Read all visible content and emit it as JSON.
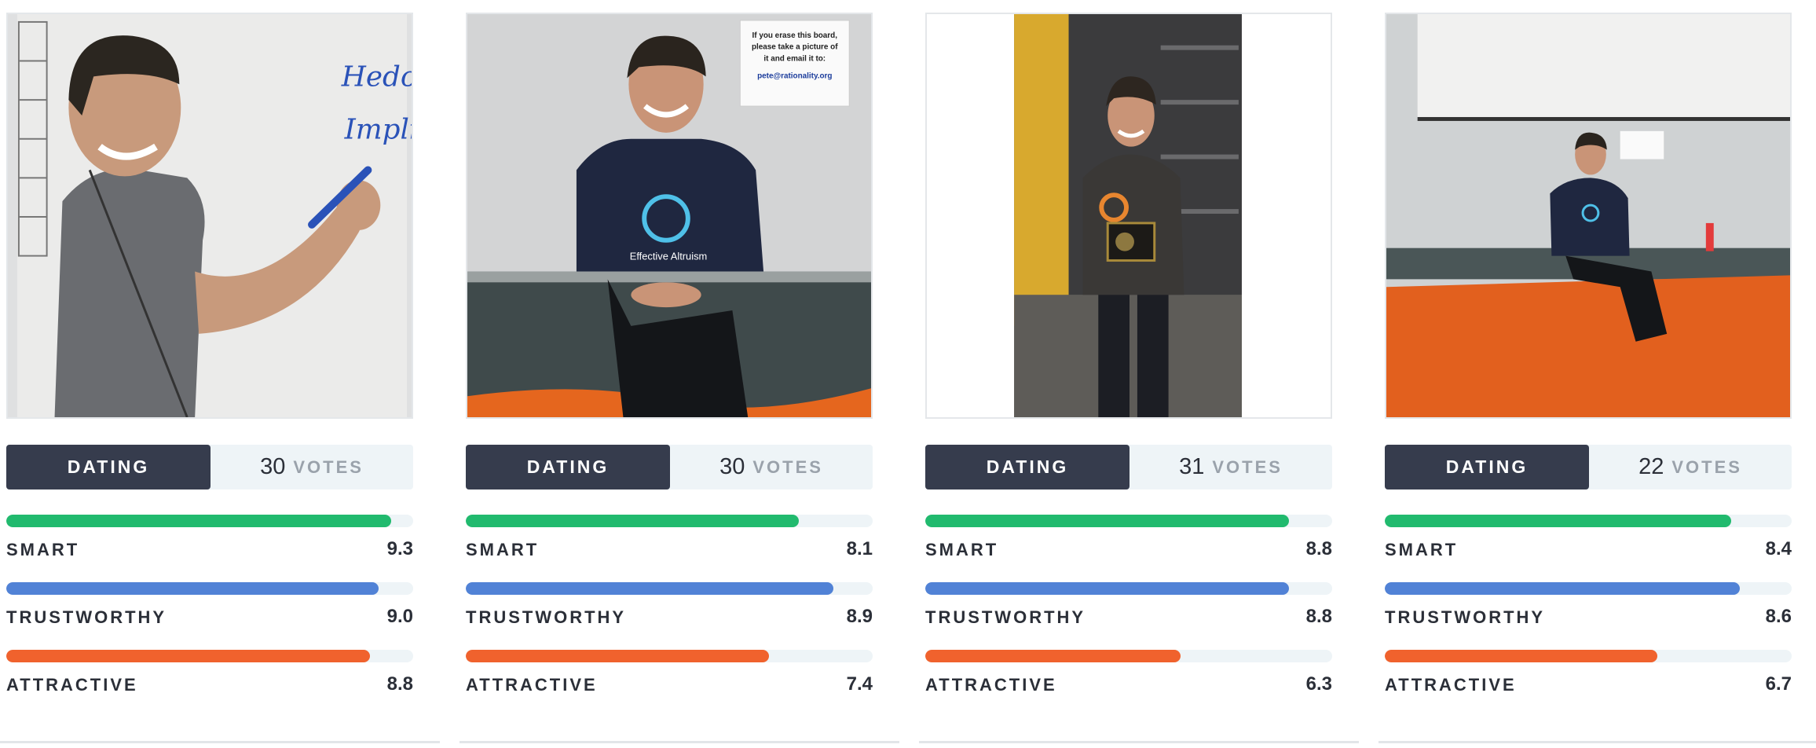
{
  "colors": {
    "smart": "#21ba6e",
    "trustworthy": "#5182d6",
    "attractive": "#f0622d",
    "tab_active": "#363c4d",
    "tab_bg": "#eef4f7"
  },
  "cards": [
    {
      "photo_icon": "photo-whiteboard",
      "tab": "DATING",
      "votes": "30",
      "votes_label": "VOTES",
      "metrics": [
        {
          "label": "SMART",
          "value": "9.3",
          "score": 9.3
        },
        {
          "label": "TRUSTWORTHY",
          "value": "9.0",
          "score": 9.0
        },
        {
          "label": "ATTRACTIVE",
          "value": "8.8",
          "score": 8.8
        }
      ]
    },
    {
      "photo_icon": "photo-sitting-wall",
      "tab": "DATING",
      "votes": "30",
      "votes_label": "VOTES",
      "metrics": [
        {
          "label": "SMART",
          "value": "8.1",
          "score": 8.1
        },
        {
          "label": "TRUSTWORTHY",
          "value": "8.9",
          "score": 8.9
        },
        {
          "label": "ATTRACTIVE",
          "value": "7.4",
          "score": 7.4
        }
      ]
    },
    {
      "photo_icon": "photo-holding-plaque",
      "tab": "DATING",
      "votes": "31",
      "votes_label": "VOTES",
      "metrics": [
        {
          "label": "SMART",
          "value": "8.8",
          "score": 8.8
        },
        {
          "label": "TRUSTWORTHY",
          "value": "8.8",
          "score": 8.8
        },
        {
          "label": "ATTRACTIVE",
          "value": "6.3",
          "score": 6.3
        }
      ]
    },
    {
      "photo_icon": "photo-orange-rug",
      "tab": "DATING",
      "votes": "22",
      "votes_label": "VOTES",
      "metrics": [
        {
          "label": "SMART",
          "value": "8.4",
          "score": 8.4
        },
        {
          "label": "TRUSTWORTHY",
          "value": "8.6",
          "score": 8.6
        },
        {
          "label": "ATTRACTIVE",
          "value": "6.7",
          "score": 6.7
        }
      ]
    }
  ],
  "photo_text": {
    "whiteboard_1": "Hedon",
    "whiteboard_2": "Impli",
    "sign_1": "If you erase this board,",
    "sign_2": "please take a picture of",
    "sign_3": "it and email it to:",
    "sign_4": "pete@rationality.org",
    "shirt": "Effective Altruism"
  }
}
